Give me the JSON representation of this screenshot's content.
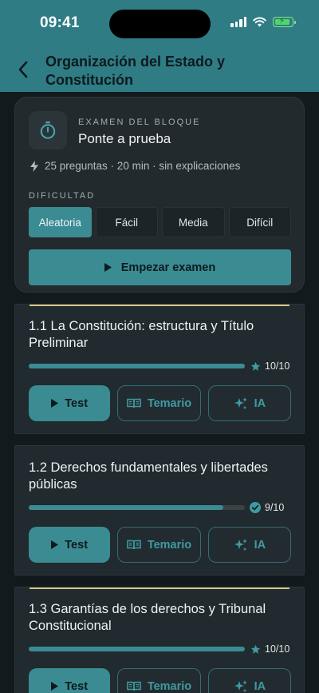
{
  "status": {
    "time": "09:41"
  },
  "header": {
    "title": "Organización del Estado y Constitución"
  },
  "exam": {
    "kicker": "EXAMEN DEL BLOQUE",
    "title": "Ponte a prueba",
    "meta": "25 preguntas · 20 min · sin explicaciones",
    "difficulty_label": "DIFICULTAD",
    "difficulties": [
      "Aleatoria",
      "Fácil",
      "Media",
      "Difícil"
    ],
    "selected_difficulty": "Aleatoria",
    "start_label": "Empezar examen"
  },
  "topics": [
    {
      "title": "1.1 La Constitución: estructura y Título Preliminar",
      "progress": 1.0,
      "count": "10/10",
      "status_icon": "star-icon"
    },
    {
      "title": "1.2 Derechos fundamentales y libertades públicas",
      "progress": 0.9,
      "count": "9/10",
      "status_icon": "check-circle-icon"
    },
    {
      "title": "1.3 Garantías de los derechos y Tribunal Constitucional",
      "progress": 1.0,
      "count": "10/10",
      "status_icon": "star-icon"
    }
  ],
  "actions": {
    "test_label": "Test",
    "syllabus_label": "Temario",
    "ai_label": "IA"
  },
  "colors": {
    "accent": "#3b8b93",
    "header": "#2f7c85",
    "highlight": "#d8c48a"
  }
}
